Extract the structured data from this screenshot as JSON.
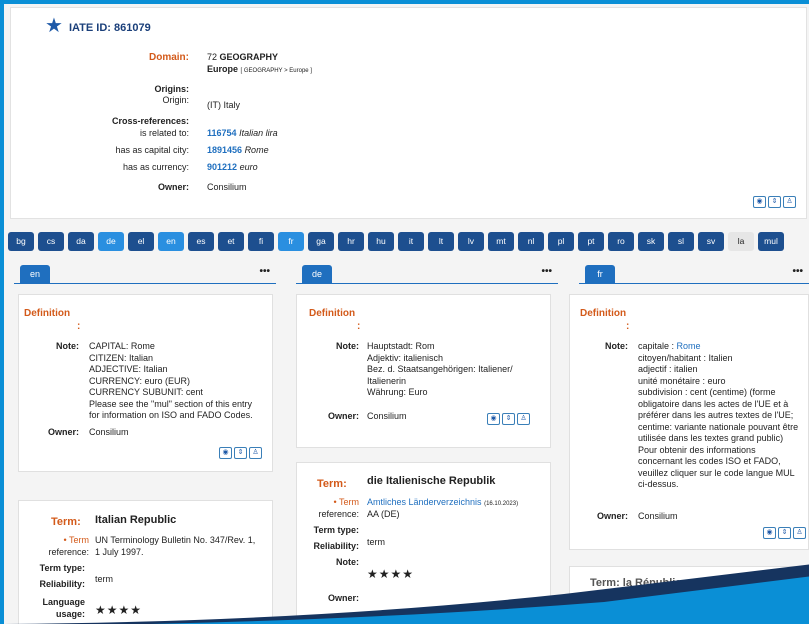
{
  "header": {
    "iate_id": "IATE ID: 861079",
    "domain_label": "Domain:",
    "domain_code": "72",
    "domain_name": "GEOGRAPHY",
    "domain_sub": "Europe",
    "domain_path": "[ GEOGRAPHY > Europe ]",
    "origins_label": "Origins:",
    "origin_label": "Origin:",
    "origin_value": "(IT) Italy",
    "xref_label": "Cross-references:",
    "xrefs": [
      {
        "rel": "is related to:",
        "id": "116754",
        "name": "Italian lira"
      },
      {
        "rel": "has as capital city:",
        "id": "1891456",
        "name": "Rome"
      },
      {
        "rel": "has as currency:",
        "id": "901212",
        "name": "euro"
      }
    ],
    "owner_label": "Owner:",
    "owner_value": "Consilium"
  },
  "languages": [
    {
      "code": "bg",
      "state": "normal"
    },
    {
      "code": "cs",
      "state": "normal"
    },
    {
      "code": "da",
      "state": "normal"
    },
    {
      "code": "de",
      "state": "active"
    },
    {
      "code": "el",
      "state": "normal"
    },
    {
      "code": "en",
      "state": "active"
    },
    {
      "code": "es",
      "state": "normal"
    },
    {
      "code": "et",
      "state": "normal"
    },
    {
      "code": "fi",
      "state": "normal"
    },
    {
      "code": "fr",
      "state": "active"
    },
    {
      "code": "ga",
      "state": "normal"
    },
    {
      "code": "hr",
      "state": "normal"
    },
    {
      "code": "hu",
      "state": "normal"
    },
    {
      "code": "it",
      "state": "normal"
    },
    {
      "code": "lt",
      "state": "normal"
    },
    {
      "code": "lv",
      "state": "normal"
    },
    {
      "code": "mt",
      "state": "normal"
    },
    {
      "code": "nl",
      "state": "normal"
    },
    {
      "code": "pl",
      "state": "normal"
    },
    {
      "code": "pt",
      "state": "normal"
    },
    {
      "code": "ro",
      "state": "normal"
    },
    {
      "code": "sk",
      "state": "normal"
    },
    {
      "code": "sl",
      "state": "normal"
    },
    {
      "code": "sv",
      "state": "normal"
    },
    {
      "code": "la",
      "state": "grey"
    },
    {
      "code": "mul",
      "state": "normal"
    }
  ],
  "columns": {
    "en": {
      "tab": "en",
      "definition_title": "Definition",
      "definition_colon": ":",
      "note_label": "Note:",
      "note_lines": [
        "CAPITAL: Rome",
        "CITIZEN: Italian",
        "ADJECTIVE: Italian",
        "CURRENCY: euro (EUR)",
        "CURRENCY SUBUNIT: cent",
        "Please see the \"mul\" section of this entry",
        "for information on ISO and FADO Codes."
      ],
      "owner_label": "Owner:",
      "owner_value": "Consilium",
      "term_label": "Term:",
      "term_name": "Italian Republic",
      "term_ref_label_1": "• Term",
      "term_ref_label_2": "reference:",
      "term_ref_lines": [
        "UN Terminology Bulletin No. 347/Rev. 1,",
        "1 July 1997."
      ],
      "term_type_label": "Term type:",
      "reliability_label": "Reliability:",
      "term_type_value": "term",
      "lang_usage_label_1": "Language",
      "lang_usage_label_2": "usage:",
      "stars": "★★★★"
    },
    "de": {
      "tab": "de",
      "definition_title": "Definition",
      "definition_colon": ":",
      "note_label": "Note:",
      "note_lines": [
        "Hauptstadt: Rom",
        "Adjektiv: italienisch",
        "Bez. d. Staatsangehörigen: Italiener/",
        "Italienerin",
        "Währung: Euro"
      ],
      "owner_label": "Owner:",
      "owner_value": "Consilium",
      "term_label": "Term:",
      "term_name": "die Italienische Republik",
      "term_ref_label_1": "• Term",
      "term_ref_label_2": "reference:",
      "term_ref_link": "Amtliches Länderverzeichnis",
      "term_ref_date": "(16.10.2023)",
      "term_ref_extra": "AA (DE)",
      "term_type_label": "Term type:",
      "reliability_label": "Reliability:",
      "term_type_value": "term",
      "note2_label": "Note:",
      "stars": "★★★★",
      "owner2_label": "Owner:"
    },
    "fr": {
      "tab": "fr",
      "definition_title": "Definition",
      "definition_colon": ":",
      "note_label": "Note:",
      "note_first_prefix": "capitale : ",
      "note_first_link": "Rome",
      "note_lines": [
        "citoyen/habitant : Italien",
        "adjectif : italien",
        "unité monétaire : euro",
        "subdivision : cent (centime) (forme",
        "obligatoire dans les actes de l'UE et à",
        "préférer dans les autres textes de l'UE;",
        "centime: variante nationale pouvant être",
        "utilisée dans les textes grand public)",
        "Pour obtenir des informations",
        "concernant les codes ISO et FADO,",
        "veuillez cliquer sur le code langue MUL",
        "ci-dessus."
      ],
      "owner_label": "Owner:",
      "owner_value": "Consilium",
      "term_partial": "Term: la République"
    }
  },
  "icons": {
    "star": "star-icon",
    "more": "more-dots-icon",
    "view": "view-icon",
    "expand": "expand-icon",
    "person": "person-icon"
  },
  "colors": {
    "frame": "#0a8fd6",
    "tab": "#1d4f8f",
    "tab_active": "#2a8fe0",
    "label_orange": "#d35a1a",
    "link": "#1f6fbf"
  }
}
